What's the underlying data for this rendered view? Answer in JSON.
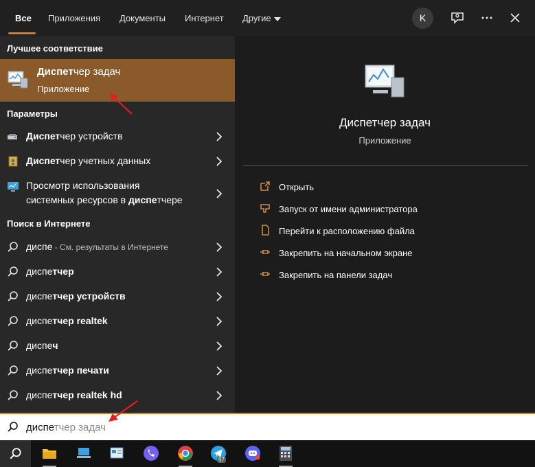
{
  "tabs": [
    {
      "label": "Все"
    },
    {
      "label": "Приложения"
    },
    {
      "label": "Документы"
    },
    {
      "label": "Интернет"
    },
    {
      "label": "Другие"
    }
  ],
  "avatar": "K",
  "sections": {
    "best_match": "Лучшее соответствие",
    "settings": "Параметры",
    "web": "Поиск в Интернете"
  },
  "best_match": {
    "title_bold": "Диспет",
    "title_rest": "чер задач",
    "subtitle": "Приложение"
  },
  "settings_items": [
    {
      "bold": "Диспет",
      "rest": "чер устройств"
    },
    {
      "bold": "Диспет",
      "rest": "чер учетных данных"
    },
    {
      "line1": "Просмотр использования",
      "line2_pre": "системных ресурсов в ",
      "line2_bold": "диспе",
      "line2_rest": "тчере"
    }
  ],
  "web_items": [
    {
      "pre": "диспе",
      "bold": "",
      "suffix": " - См. результаты в Интернете"
    },
    {
      "pre": "диспе",
      "bold": "тчер"
    },
    {
      "pre": "диспе",
      "bold": "тчер устройств"
    },
    {
      "pre": "диспе",
      "bold": "тчер realtek"
    },
    {
      "pre": "диспе",
      "bold": "ч"
    },
    {
      "pre": "диспе",
      "bold": "тчер печати"
    },
    {
      "pre": "диспе",
      "bold": "тчер realtek hd"
    }
  ],
  "detail": {
    "title": "Диспетчер задач",
    "subtitle": "Приложение",
    "actions": [
      {
        "label": "Открыть",
        "icon": "open-icon"
      },
      {
        "label": "Запуск от имени администратора",
        "icon": "shield-icon"
      },
      {
        "label": "Перейти к расположению файла",
        "icon": "file-location-icon"
      },
      {
        "label": "Закрепить на начальном экране",
        "icon": "pin-icon"
      },
      {
        "label": "Закрепить на панели задач",
        "icon": "pin-icon"
      }
    ]
  },
  "search": {
    "typed": "диспе",
    "suggestion": "тчер задач"
  },
  "taskbar": {
    "telegram_badge": "97"
  },
  "colors": {
    "accent": "#d97a2c",
    "selected_row": "#8b5a2b"
  }
}
